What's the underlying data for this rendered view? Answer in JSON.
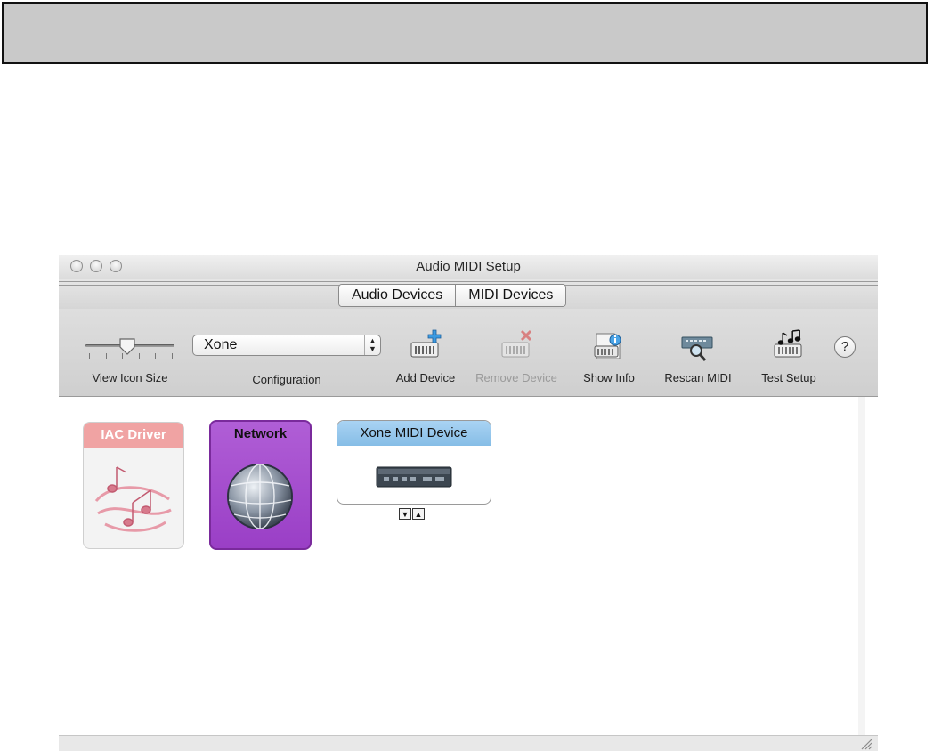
{
  "window": {
    "title": "Audio MIDI Setup"
  },
  "tabs": [
    {
      "label": "Audio Devices"
    },
    {
      "label": "MIDI Devices"
    }
  ],
  "toolbar": {
    "view_icon_size_label": "View Icon Size",
    "configuration": {
      "value": "Xone",
      "label": "Configuration"
    },
    "add_device_label": "Add Device",
    "remove_device_label": "Remove Device",
    "show_info_label": "Show Info",
    "rescan_midi_label": "Rescan MIDI",
    "test_setup_label": "Test Setup",
    "help_label": "?"
  },
  "devices": [
    {
      "name": "IAC Driver",
      "color": "#f0a3a3"
    },
    {
      "name": "Network",
      "color": "#a24cce"
    },
    {
      "name": "Xone MIDI Device",
      "color": "#9ccaee"
    }
  ],
  "ports": {
    "down": "▼",
    "up": "▲"
  }
}
